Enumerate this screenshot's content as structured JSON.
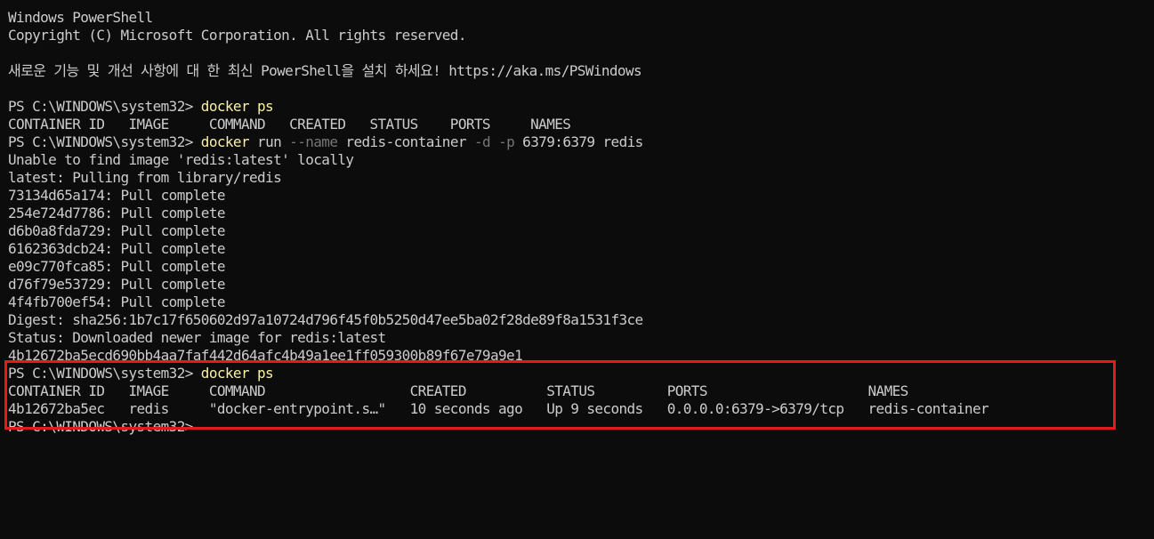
{
  "window": {
    "title": "Windows PowerShell",
    "copyright": "Copyright (C) Microsoft Corporation. All rights reserved.",
    "tip": "새로운 기능 및 개선 사항에 대 한 최신 PowerShell을 설치 하세요! https://aka.ms/PSWindows"
  },
  "prompt": "PS C:\\WINDOWS\\system32> ",
  "session": {
    "cmd1": "docker ps",
    "ps_header_empty": "CONTAINER ID   IMAGE     COMMAND   CREATED   STATUS    PORTS     NAMES",
    "cmd2_exe": "docker",
    "cmd2_sub": " run ",
    "cmd2_flag1": "--name",
    "cmd2_arg1": " redis-container ",
    "cmd2_flag2": "-d",
    "cmd2_sp": " ",
    "cmd2_flag3": "-p",
    "cmd2_rest": " 6379:6379 redis",
    "pull_lines": [
      "Unable to find image 'redis:latest' locally",
      "latest: Pulling from library/redis",
      "73134d65a174: Pull complete",
      "254e724d7786: Pull complete",
      "d6b0a8fda729: Pull complete",
      "6162363dcb24: Pull complete",
      "e09c770fca85: Pull complete",
      "d76f79e53729: Pull complete",
      "4f4fb700ef54: Pull complete",
      "Digest: sha256:1b7c17f650602d97a10724d796f45f0b5250d47ee5ba02f28de89f8a1531f3ce",
      "Status: Downloaded newer image for redis:latest",
      "4b12672ba5ecd690bb4aa7faf442d64afc4b49a1ee1ff059300b89f67e79a9e1"
    ],
    "cmd3": "docker ps",
    "ps_header": "CONTAINER ID   IMAGE     COMMAND                  CREATED          STATUS         PORTS                    NAMES",
    "ps_row": "4b12672ba5ec   redis     \"docker-entrypoint.s…\"   10 seconds ago   Up 9 seconds   0.0.0.0:6379->6379/tcp   redis-container"
  },
  "colors": {
    "background": "#0c0c0c",
    "text": "#cccccc",
    "command": "#f9f1a5",
    "parameter": "#767676",
    "highlight": "#e51b1b"
  }
}
